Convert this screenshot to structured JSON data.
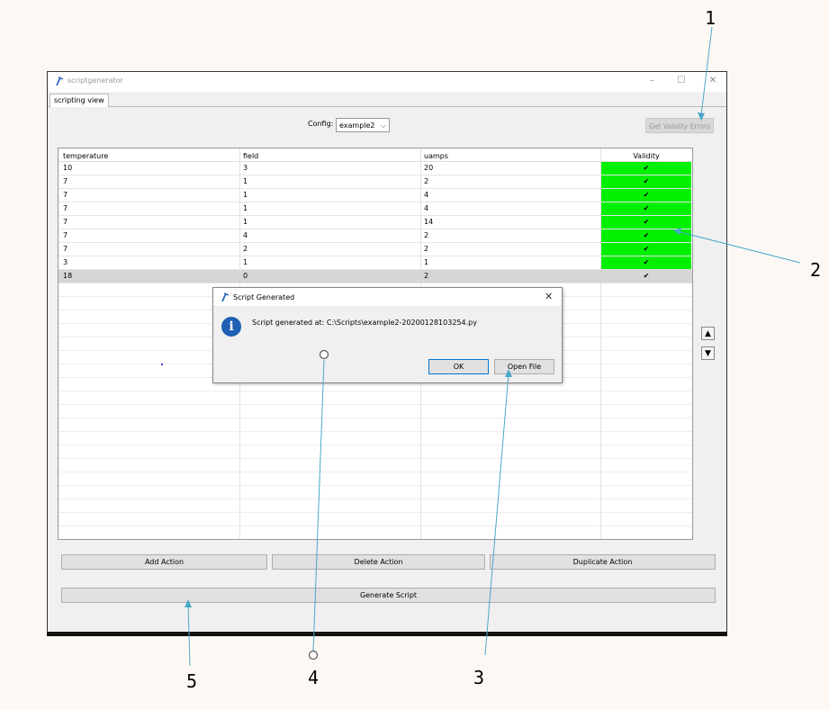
{
  "window": {
    "title": "scriptgenerator",
    "controls": {
      "minimize": "–",
      "maximize": "☐",
      "close": "✕"
    }
  },
  "tab": {
    "label": "scripting view"
  },
  "config": {
    "label": "Config:",
    "value": "example2"
  },
  "validity_button": {
    "label": "Get Validity Errors"
  },
  "table": {
    "columns": [
      "temperature",
      "field",
      "uamps",
      "Validity"
    ],
    "rows": [
      {
        "temperature": "10",
        "field": "3",
        "uamps": "20",
        "validity": "✔",
        "valid": true
      },
      {
        "temperature": "7",
        "field": "1",
        "uamps": "2",
        "validity": "✔",
        "valid": true
      },
      {
        "temperature": "7",
        "field": "1",
        "uamps": "4",
        "validity": "✔",
        "valid": true
      },
      {
        "temperature": "7",
        "field": "1",
        "uamps": "4",
        "validity": "✔",
        "valid": true
      },
      {
        "temperature": "7",
        "field": "1",
        "uamps": "14",
        "validity": "✔",
        "valid": true
      },
      {
        "temperature": "7",
        "field": "4",
        "uamps": "2",
        "validity": "✔",
        "valid": true
      },
      {
        "temperature": "7",
        "field": "2",
        "uamps": "2",
        "validity": "✔",
        "valid": true
      },
      {
        "temperature": "3",
        "field": "1",
        "uamps": "1",
        "validity": "✔",
        "valid": true
      },
      {
        "temperature": "18",
        "field": "0",
        "uamps": "2",
        "validity": "✔",
        "valid": false,
        "selected": true
      }
    ]
  },
  "move_buttons": {
    "up": "▲",
    "down": "▼"
  },
  "actions": {
    "add": "Add Action",
    "delete": "Delete Action",
    "duplicate": "Duplicate Action",
    "generate": "Generate Script"
  },
  "dialog": {
    "title": "Script Generated",
    "message": "Script generated at: C:\\Scripts\\example2-20200128103254.py",
    "ok": "OK",
    "open_file": "Open File",
    "info_glyph": "i",
    "close_glyph": "✕"
  },
  "callouts": [
    "1",
    "2",
    "3",
    "4",
    "5"
  ],
  "colors": {
    "valid": "#00f000",
    "annotation": "#4aa8c8",
    "info_icon": "#1f5fb4"
  }
}
